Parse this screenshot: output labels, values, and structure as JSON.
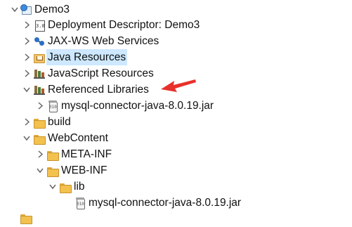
{
  "tree": {
    "items": [
      {
        "label": "Demo3",
        "icon": "project-icon",
        "expanded": true,
        "selected": false
      },
      {
        "label": "Deployment Descriptor: Demo3",
        "icon": "deployment-descriptor-icon",
        "expanded": false,
        "selected": false
      },
      {
        "label": "JAX-WS Web Services",
        "icon": "web-services-icon",
        "expanded": false,
        "selected": false
      },
      {
        "label": "Java Resources",
        "icon": "java-resources-icon",
        "expanded": false,
        "selected": true
      },
      {
        "label": "JavaScript Resources",
        "icon": "library-icon",
        "expanded": false,
        "selected": false
      },
      {
        "label": "Referenced Libraries",
        "icon": "library-icon",
        "expanded": true,
        "selected": false
      },
      {
        "label": "mysql-connector-java-8.0.19.jar",
        "icon": "jar-icon",
        "expanded": false,
        "selected": false
      },
      {
        "label": "build",
        "icon": "folder-icon",
        "expanded": false,
        "selected": false
      },
      {
        "label": "WebContent",
        "icon": "folder-icon",
        "expanded": true,
        "selected": false
      },
      {
        "label": "META-INF",
        "icon": "folder-icon",
        "expanded": false,
        "selected": false
      },
      {
        "label": "WEB-INF",
        "icon": "folder-icon",
        "expanded": true,
        "selected": false
      },
      {
        "label": "lib",
        "icon": "folder-icon",
        "expanded": true,
        "selected": false
      },
      {
        "label": "mysql-connector-java-8.0.19.jar",
        "icon": "jar-icon",
        "expanded": false,
        "selected": false
      }
    ],
    "jar_icon_text": "010",
    "descriptor_icon_text": "3.0"
  },
  "annotation": {
    "color": "#e8312b",
    "icon": "red-arrow-annotation"
  }
}
